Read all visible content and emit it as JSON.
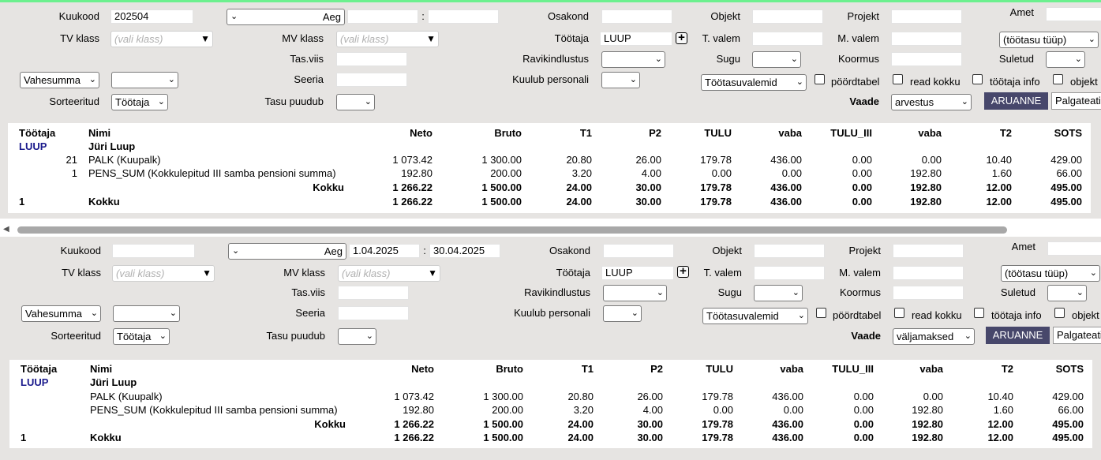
{
  "labels": {
    "kuukood": "Kuukood",
    "tv_klass": "TV klass",
    "mv_klass": "MV klass",
    "tas_viis": "Tas.viis",
    "seeria": "Seeria",
    "sorteeritud": "Sorteeritud",
    "tasu_puudub": "Tasu puudub",
    "osakond": "Osakond",
    "tootaja": "Töötaja",
    "ravikindlustus": "Ravikindlustus",
    "kuulub_personali": "Kuulub personali",
    "objekt": "Objekt",
    "t_valem": "T. valem",
    "sugu": "Sugu",
    "projekt": "Projekt",
    "m_valem": "M. valem",
    "koormus": "Koormus",
    "amet": "Amet",
    "suletud": "Suletud",
    "vaade": "Vaade",
    "pordtabel": "pöördtabel",
    "read_kokku": "read kokku",
    "tootaja_info": "töötaja info",
    "objekt_chk": "objekt"
  },
  "panels": [
    {
      "kuukood": "202504",
      "aeg": "Aeg",
      "date_sep": ":",
      "date_from": "",
      "date_to": "",
      "tv_klass_ph": "(vali klass)",
      "mv_klass_ph": "(vali klass)",
      "tootaja_value": "LUUP",
      "tootasu_tuup": "(töötasu tüüp)",
      "vahesumma": "Vahesumma",
      "sort_value": "Töötaja",
      "tootasuvalemid": "Töötasuvalemid",
      "vaade_value": "arvestus",
      "report_button": "ARUANNE",
      "palgateatis": "Palgateatis"
    },
    {
      "kuukood": "",
      "aeg": "Aeg",
      "date_sep": ":",
      "date_from": "1.04.2025",
      "date_to": "30.04.2025",
      "tv_klass_ph": "(vali klass)",
      "mv_klass_ph": "(vali klass)",
      "tootaja_value": "LUUP",
      "tootasu_tuup": "(töötasu tüüp)",
      "vahesumma": "Vahesumma",
      "sort_value": "Töötaja",
      "tootasuvalemid": "Töötasuvalemid",
      "vaade_value": "väljamaksed",
      "report_button": "ARUANNE",
      "palgateatis": "Palgateatis"
    }
  ],
  "columns": [
    "Töötaja",
    "Nimi",
    "Neto",
    "Bruto",
    "T1",
    "P2",
    "TULU",
    "vaba",
    "TULU_III",
    "vaba",
    "T2",
    "SOTS"
  ],
  "tables": [
    {
      "employee_code": "LUUP",
      "employee_name": "Jüri Luup",
      "rows": [
        {
          "code": "21",
          "name": "PALK (Kuupalk)",
          "values": [
            "1 073.42",
            "1 300.00",
            "20.80",
            "26.00",
            "179.78",
            "436.00",
            "0.00",
            "0.00",
            "10.40",
            "429.00"
          ]
        },
        {
          "code": "1",
          "name": "PENS_SUM (Kokkulepitud III samba pensioni summa)",
          "values": [
            "192.80",
            "200.00",
            "3.20",
            "4.00",
            "0.00",
            "0.00",
            "0.00",
            "192.80",
            "1.60",
            "66.00"
          ]
        }
      ],
      "subtotal": {
        "label": "Kokku",
        "values": [
          "1 266.22",
          "1 500.00",
          "24.00",
          "30.00",
          "179.78",
          "436.00",
          "0.00",
          "192.80",
          "12.00",
          "495.00"
        ]
      },
      "total": {
        "count": "1",
        "label": "Kokku",
        "values": [
          "1 266.22",
          "1 500.00",
          "24.00",
          "30.00",
          "179.78",
          "436.00",
          "0.00",
          "192.80",
          "12.00",
          "495.00"
        ]
      }
    },
    {
      "employee_code": "LUUP",
      "employee_name": "Jüri Luup",
      "rows": [
        {
          "code": "",
          "name": "PALK (Kuupalk)",
          "values": [
            "1 073.42",
            "1 300.00",
            "20.80",
            "26.00",
            "179.78",
            "436.00",
            "0.00",
            "0.00",
            "10.40",
            "429.00"
          ]
        },
        {
          "code": "",
          "name": "PENS_SUM (Kokkulepitud III samba pensioni summa)",
          "values": [
            "192.80",
            "200.00",
            "3.20",
            "4.00",
            "0.00",
            "0.00",
            "0.00",
            "192.80",
            "1.60",
            "66.00"
          ]
        }
      ],
      "subtotal": {
        "label": "Kokku",
        "values": [
          "1 266.22",
          "1 500.00",
          "24.00",
          "30.00",
          "179.78",
          "436.00",
          "0.00",
          "192.80",
          "12.00",
          "495.00"
        ]
      },
      "total": {
        "count": "1",
        "label": "Kokku",
        "values": [
          "1 266.22",
          "1 500.00",
          "24.00",
          "30.00",
          "179.78",
          "436.00",
          "0.00",
          "192.80",
          "12.00",
          "495.00"
        ]
      }
    }
  ],
  "colors": {
    "top_border": "#6cf08f",
    "panel_bg": "#e6e4e2",
    "button": "#47476b",
    "employee_code": "#1a1a8c"
  }
}
